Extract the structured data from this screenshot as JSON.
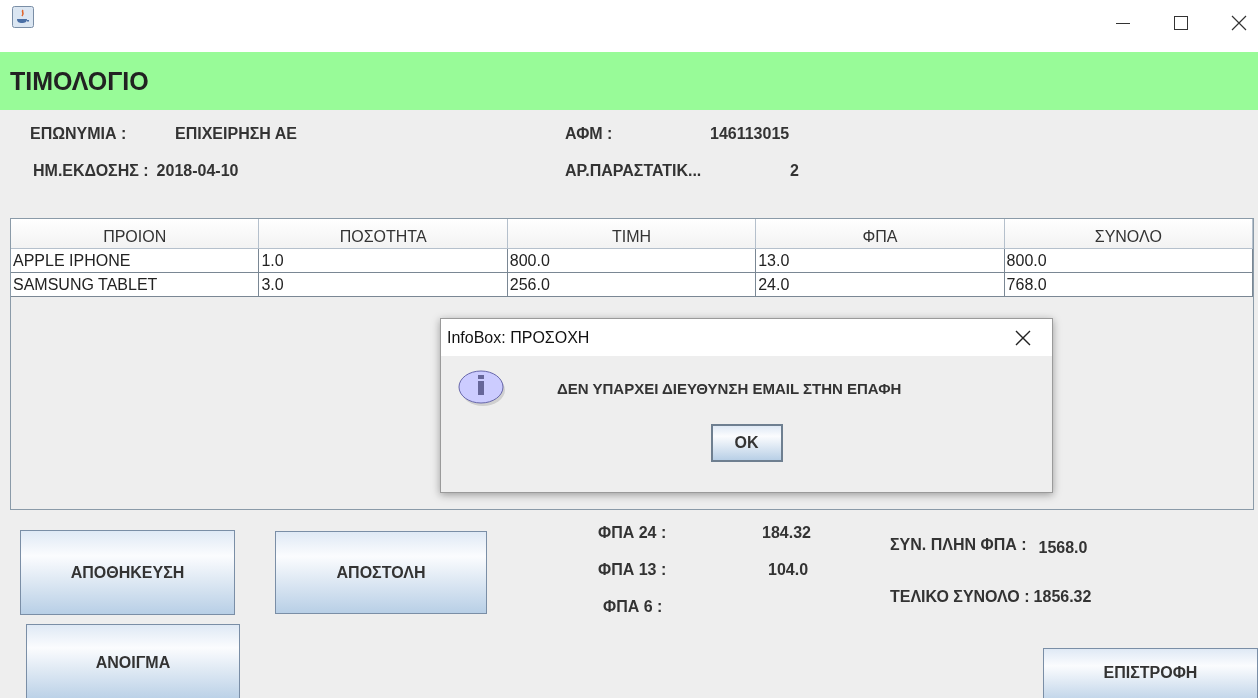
{
  "header": {
    "title": "ΤΙΜΟΛΟΓΙΟ"
  },
  "info": [
    {
      "label": "ΕΠΩΝΥΜΙΑ :",
      "value": "ΕΠΙΧΕΙΡΗΣΗ ΑΕ"
    },
    {
      "label": "ΑΦΜ :",
      "value": "146113015"
    },
    {
      "label": "ΗΜ.ΕΚΔΟΣΗΣ :",
      "value": "2018-04-10"
    },
    {
      "label": "ΑΡ.ΠΑΡΑΣΤΑΤΙΚ...",
      "value": "2"
    }
  ],
  "table": {
    "columns": [
      "ΠΡΟΙΟΝ",
      "ΠΟΣΟΤΗΤΑ",
      "ΤΙΜΗ",
      "ΦΠΑ",
      "ΣΥΝΟΛΟ"
    ],
    "rows": [
      [
        "APPLE IPHONE",
        "1.0",
        "800.0",
        "13.0",
        "800.0"
      ],
      [
        "SAMSUNG TABLET",
        "3.0",
        "256.0",
        "24.0",
        "768.0"
      ]
    ]
  },
  "buttons": [
    "ΑΠΟΘΗΚΕΥΣΗ",
    "ΑΠΟΣΤΟΛΗ",
    "ΑΝΟΙΓΜΑ"
  ],
  "vat": [
    {
      "label": "ΦΠΑ 24 :",
      "value": "184.32"
    },
    {
      "label": "ΦΠΑ 13 :",
      "value": "104.0"
    },
    {
      "label": "ΦΠΑ 6 :"
    }
  ],
  "totals": [
    {
      "label": "ΣΥΝ. ΠΛΗΝ ΦΠΑ :",
      "value": "1568.0"
    },
    {
      "label": "ΤΕΛΙΚΟ ΣΥΝΟΛΟ :",
      "value": "1856.32"
    }
  ],
  "return_button": "ΕΠΙΣΤΡΟΦΗ",
  "dialog": {
    "title": "InfoBox: ΠΡΟΣΟΧΗ",
    "message": "ΔΕΝ ΥΠΑΡΧΕΙ ΔΙΕΥΘΥΝΣΗ EMAIL ΣΤΗΝ ΕΠΑΦΗ",
    "button": "OK"
  }
}
